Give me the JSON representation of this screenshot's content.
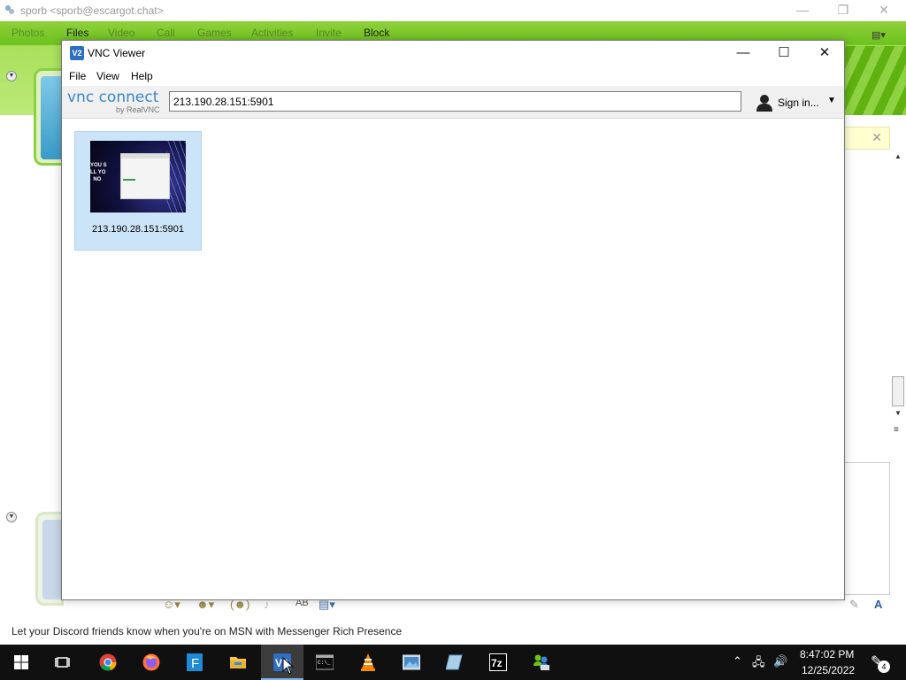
{
  "messenger": {
    "title": "sporb <sporb@escargot.chat>",
    "menu": [
      "Photos",
      "Files",
      "Video",
      "Call",
      "Games",
      "Activities",
      "Invite",
      "Block"
    ],
    "status_text": "Let your Discord friends know when you're on MSN with Messenger Rich Presence"
  },
  "vnc": {
    "title": "VNC Viewer",
    "menu": {
      "file": "File",
      "view": "View",
      "help": "Help"
    },
    "logo": {
      "brand": "vnc connect",
      "sub": "by RealVNC"
    },
    "address_value": "213.190.28.151:5901",
    "signin_label": "Sign in...",
    "connections": [
      {
        "label": "213.190.28.151:5901",
        "thumbnail_text": "YOU S\nLL YO\nNO"
      }
    ]
  },
  "taskbar": {
    "apps": [
      "start-icon",
      "task-view-icon",
      "chrome-icon",
      "firefox-icon",
      "fluent-app-icon",
      "file-explorer-icon",
      "vnc-viewer-icon",
      "terminal-icon",
      "vlc-icon",
      "photos-icon",
      "notepad-icon",
      "7zip-icon",
      "messenger-icon"
    ],
    "time": "8:47:02 PM",
    "date": "12/25/2022",
    "notification_count": "4"
  },
  "colors": {
    "msn_green": "#6cc21e",
    "vnc_blue": "#3a86c8",
    "tile_selected": "#cce4f7",
    "taskbar": "#101010"
  }
}
